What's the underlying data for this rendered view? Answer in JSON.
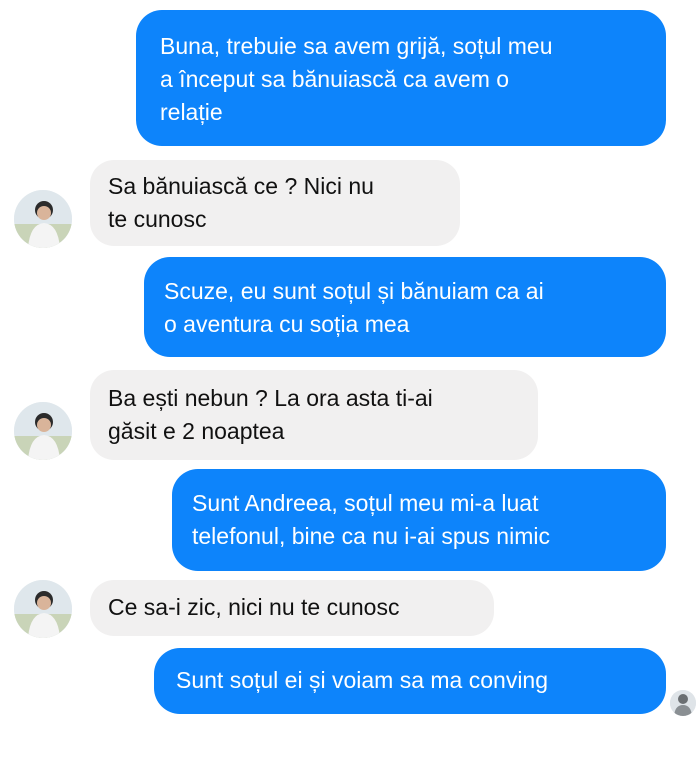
{
  "conversation": {
    "messages": [
      {
        "direction": "outgoing",
        "text": "Buna, trebuie sa avem grijă, soțul meu\na început sa bănuiască ca avem o\nrelație"
      },
      {
        "direction": "incoming",
        "text": "Sa bănuiască ce ? Nici nu\nte cunosc"
      },
      {
        "direction": "outgoing",
        "text": "Scuze, eu sunt soțul și bănuiam ca ai\no aventura cu soția mea"
      },
      {
        "direction": "incoming",
        "text": "Ba ești nebun ? La ora asta ti-ai\ngăsit e 2 noaptea"
      },
      {
        "direction": "outgoing",
        "text": "Sunt Andreea, soțul meu mi-a luat\ntelefonul, bine ca nu i-ai spus nimic"
      },
      {
        "direction": "incoming",
        "text": "Ce sa-i zic, nici nu te cunosc"
      },
      {
        "direction": "outgoing",
        "text": "Sunt soțul ei și voiam sa ma conving"
      }
    ]
  },
  "icons": {
    "contact_avatar": "person-avatar-icon",
    "read_receipt": "seen-avatar-icon"
  },
  "colors": {
    "outgoing_bubble": "#0d84fb",
    "incoming_bubble": "#f1f0f0",
    "outgoing_text": "#ffffff",
    "incoming_text": "#111111",
    "background": "#ffffff"
  }
}
